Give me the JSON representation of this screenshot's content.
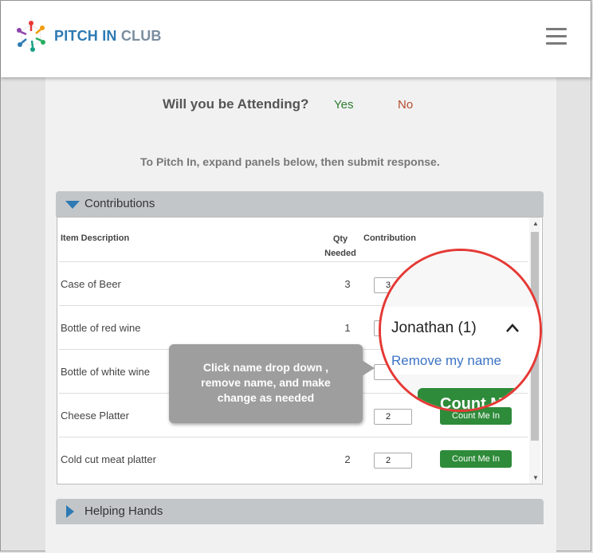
{
  "header": {
    "brand_pitch": "PITCH IN",
    "brand_club": "CLUB"
  },
  "attendance": {
    "question": "Will you be Attending?",
    "yes_label": "Yes",
    "no_label": "No"
  },
  "instruction": "To Pitch In, expand panels below, then submit response.",
  "contributions": {
    "panel_label": "Contributions",
    "columns": {
      "item": "Item Description",
      "qty": "Qty Needed",
      "contribution": "Contribution"
    },
    "rows": [
      {
        "item": "Case of Beer",
        "qty": "3",
        "contribution": "3",
        "button": ""
      },
      {
        "item": "Bottle of red wine",
        "qty": "1",
        "contribution": "",
        "button": ""
      },
      {
        "item": "Bottle of white wine",
        "qty": "",
        "contribution": "",
        "button": ""
      },
      {
        "item": "Cheese Platter",
        "qty": "",
        "contribution": "2",
        "button": "Count Me In"
      },
      {
        "item": "Cold cut meat platter",
        "qty": "2",
        "contribution": "2",
        "button": "Count Me In"
      }
    ]
  },
  "helping_hands": {
    "panel_label": "Helping Hands"
  },
  "tooltip": {
    "text": "Click name drop down , remove name, and make change as needed"
  },
  "magnifier": {
    "name": "Jonathan (1)",
    "remove": "Remove my name",
    "button": "Count M"
  },
  "colors": {
    "brand_blue": "#2e7ab3",
    "button_green": "#2e8b3a",
    "highlight_red": "#e53935",
    "yes_green": "#2e7d32",
    "no_red": "#b34b2e"
  }
}
